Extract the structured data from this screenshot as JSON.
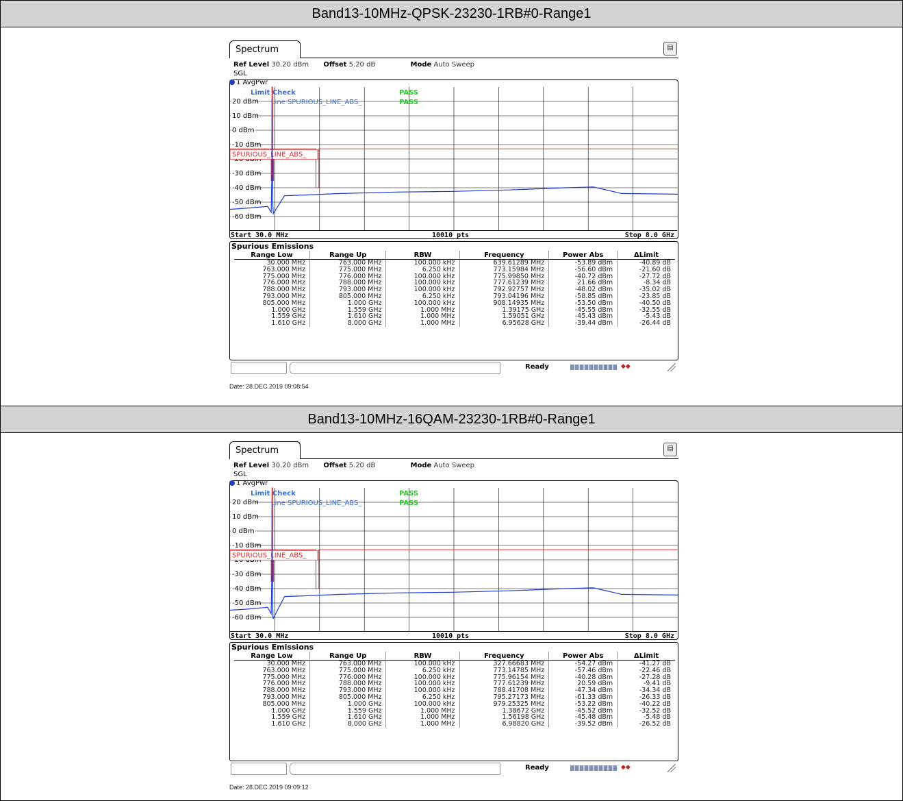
{
  "sections": [
    {
      "title": "Band13-10MHz-QPSK-23230-1RB#0-Range1",
      "tab": "Spectrum",
      "ref_level_label": "Ref Level",
      "ref_level": "30.20 dBm",
      "offset_label": "Offset",
      "offset": "5.20 dB",
      "mode_label": "Mode",
      "mode": "Auto Sweep",
      "sgl": "SGL",
      "trace": "1 AvgPwr",
      "limit_check": "Limit Check",
      "line_label": "Line",
      "line_name": "SPURIOUS_LINE_ABS",
      "pass1": "PASS",
      "pass2": "PASS",
      "limit_box_label": "SPURIOUS_LINE_ABS_",
      "start": "Start 30.0 MHz",
      "pts": "10010 pts",
      "stop": "Stop 8.0 GHz",
      "table_title": "Spurious Emissions",
      "columns": [
        "Range Low",
        "Range Up",
        "RBW",
        "Frequency",
        "Power Abs",
        "ΔLimit"
      ],
      "rows": [
        [
          "30.000 MHz",
          "763.000 MHz",
          "100.000 kHz",
          "639.61289 MHz",
          "-53.89 dBm",
          "-40.89 dB"
        ],
        [
          "763.000 MHz",
          "775.000 MHz",
          "6.250 kHz",
          "773.15984 MHz",
          "-56.60 dBm",
          "-21.60 dB"
        ],
        [
          "775.000 MHz",
          "776.000 MHz",
          "100.000 kHz",
          "775.99850 MHz",
          "-40.72 dBm",
          "-27.72 dB"
        ],
        [
          "776.000 MHz",
          "788.000 MHz",
          "100.000 kHz",
          "777.61239 MHz",
          "21.66 dBm",
          "-8.34 dB"
        ],
        [
          "788.000 MHz",
          "793.000 MHz",
          "100.000 kHz",
          "792.92757 MHz",
          "-48.02 dBm",
          "-35.02 dB"
        ],
        [
          "793.000 MHz",
          "805.000 MHz",
          "6.250 kHz",
          "793.04196 MHz",
          "-58.85 dBm",
          "-23.85 dB"
        ],
        [
          "805.000 MHz",
          "1.000 GHz",
          "100.000 kHz",
          "908.14935 MHz",
          "-53.50 dBm",
          "-40.50 dB"
        ],
        [
          "1.000 GHz",
          "1.559 GHz",
          "1.000 MHz",
          "1.39175 GHz",
          "-45.55 dBm",
          "-32.55 dB"
        ],
        [
          "1.559 GHz",
          "1.610 GHz",
          "1.000 MHz",
          "1.59051 GHz",
          "-45.43 dBm",
          "-5.43 dB"
        ],
        [
          "1.610 GHz",
          "8.000 GHz",
          "1.000 MHz",
          "6.95628 GHz",
          "-39.44 dBm",
          "-26.44 dB"
        ]
      ],
      "status": "Ready",
      "date": "Date: 28.DEC.2019  09:08:54"
    },
    {
      "title": "Band13-10MHz-16QAM-23230-1RB#0-Range1",
      "tab": "Spectrum",
      "ref_level_label": "Ref Level",
      "ref_level": "30.20 dBm",
      "offset_label": "Offset",
      "offset": "5.20 dB",
      "mode_label": "Mode",
      "mode": "Auto Sweep",
      "sgl": "SGL",
      "trace": "1 AvgPwr",
      "limit_check": "Limit Check",
      "line_label": "Line",
      "line_name": "SPURIOUS_LINE_ABS",
      "pass1": "PASS",
      "pass2": "PASS",
      "limit_box_label": "SPURIOUS_LINE_ABS_",
      "start": "Start 30.0 MHz",
      "pts": "10010 pts",
      "stop": "Stop 8.0 GHz",
      "table_title": "Spurious Emissions",
      "columns": [
        "Range Low",
        "Range Up",
        "RBW",
        "Frequency",
        "Power Abs",
        "ΔLimit"
      ],
      "rows": [
        [
          "30.000 MHz",
          "763.000 MHz",
          "100.000 kHz",
          "327.66683 MHz",
          "-54.27 dBm",
          "-41.27 dB"
        ],
        [
          "763.000 MHz",
          "775.000 MHz",
          "6.250 kHz",
          "773.14785 MHz",
          "-57.46 dBm",
          "-22.46 dB"
        ],
        [
          "775.000 MHz",
          "776.000 MHz",
          "100.000 kHz",
          "775.96154 MHz",
          "-40.28 dBm",
          "-27.28 dB"
        ],
        [
          "776.000 MHz",
          "788.000 MHz",
          "100.000 kHz",
          "777.61239 MHz",
          "20.59 dBm",
          "-9.41 dB"
        ],
        [
          "788.000 MHz",
          "793.000 MHz",
          "100.000 kHz",
          "788.41708 MHz",
          "-47.34 dBm",
          "-34.34 dB"
        ],
        [
          "793.000 MHz",
          "805.000 MHz",
          "6.250 kHz",
          "795.27173 MHz",
          "-61.33 dBm",
          "-26.33 dB"
        ],
        [
          "805.000 MHz",
          "1.000 GHz",
          "100.000 kHz",
          "979.25325 MHz",
          "-53.22 dBm",
          "-40.22 dB"
        ],
        [
          "1.000 GHz",
          "1.559 GHz",
          "1.000 MHz",
          "1.38672 GHz",
          "-45.52 dBm",
          "-32.52 dB"
        ],
        [
          "1.559 GHz",
          "1.610 GHz",
          "1.000 MHz",
          "1.56198 GHz",
          "-45.48 dBm",
          "-5.48 dB"
        ],
        [
          "1.610 GHz",
          "8.000 GHz",
          "1.000 MHz",
          "6.98820 GHz",
          "-39.52 dBm",
          "-26.52 dB"
        ]
      ],
      "status": "Ready",
      "date": "Date: 28.DEC.2019  09:09:12"
    }
  ],
  "chart_data": [
    {
      "type": "line",
      "y_ticks": [
        "20 dBm",
        "10 dBm",
        "0 dBm",
        "-10 dBm",
        "-20 dBm",
        "-30 dBm",
        "-40 dBm",
        "-50 dBm",
        "-60 dBm"
      ],
      "ylim": [
        -70,
        30
      ],
      "xlim_hz": [
        30000000,
        8000000000
      ],
      "trace_color": "#1a3ad6",
      "limit_color": "#e23030",
      "limit_line": {
        "x": [
          30000000,
          763000000,
          763000000,
          775000000,
          775000000,
          776000000,
          776000000,
          788000000,
          788000000,
          793000000,
          793000000,
          805000000,
          805000000,
          1559000000,
          1559000000,
          1610000000,
          1610000000,
          8000000000
        ],
        "y": [
          -13,
          -13,
          -35,
          -35,
          -13,
          -13,
          30,
          30,
          -13,
          -13,
          -35,
          -35,
          -13,
          -13,
          -40,
          -40,
          -13,
          -13
        ]
      },
      "trace": {
        "x": [
          30000000,
          400000000,
          700000000,
          763000000,
          770000000,
          776000000,
          777600000,
          788000000,
          800000000,
          1000000000,
          1400000000,
          2000000000,
          3000000000,
          4000000000,
          5000000000,
          6000000000,
          6500000000,
          7000000000,
          8000000000
        ],
        "y": [
          -55,
          -54,
          -53,
          -57,
          -40,
          -30,
          21.66,
          -48,
          -58,
          -45.5,
          -45,
          -44,
          -43,
          -42.5,
          -41.5,
          -40,
          -39.5,
          -44,
          -44.5
        ]
      }
    },
    {
      "type": "line",
      "y_ticks": [
        "20 dBm",
        "10 dBm",
        "0 dBm",
        "-10 dBm",
        "-20 dBm",
        "-30 dBm",
        "-40 dBm",
        "-50 dBm",
        "-60 dBm"
      ],
      "ylim": [
        -70,
        30
      ],
      "xlim_hz": [
        30000000,
        8000000000
      ],
      "trace_color": "#1a3ad6",
      "limit_color": "#e23030",
      "limit_line": {
        "x": [
          30000000,
          763000000,
          763000000,
          775000000,
          775000000,
          776000000,
          776000000,
          788000000,
          788000000,
          793000000,
          793000000,
          805000000,
          805000000,
          1559000000,
          1559000000,
          1610000000,
          1610000000,
          8000000000
        ],
        "y": [
          -13,
          -13,
          -35,
          -35,
          -13,
          -13,
          30,
          30,
          -13,
          -13,
          -35,
          -35,
          -13,
          -13,
          -40,
          -40,
          -13,
          -13
        ]
      },
      "trace": {
        "x": [
          30000000,
          327000000,
          700000000,
          763000000,
          770000000,
          776000000,
          777600000,
          788000000,
          795000000,
          1000000000,
          1386000000,
          2000000000,
          3000000000,
          4000000000,
          5000000000,
          6000000000,
          6500000000,
          7000000000,
          8000000000
        ],
        "y": [
          -55,
          -54.3,
          -53,
          -57.5,
          -40,
          -30,
          20.59,
          -47.3,
          -61,
          -45.5,
          -45,
          -44,
          -43,
          -42.5,
          -41.5,
          -40,
          -39.5,
          -44,
          -44.5
        ]
      }
    }
  ]
}
